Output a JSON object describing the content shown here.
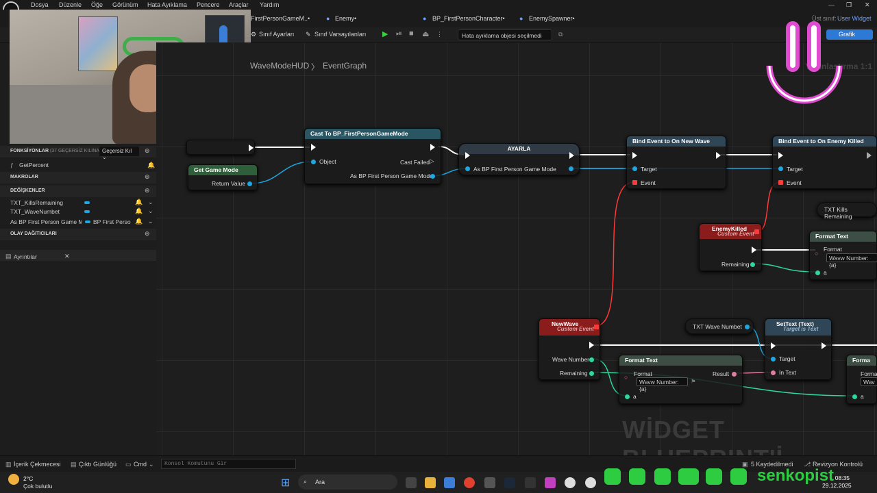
{
  "menu": [
    "Dosya",
    "Düzenle",
    "Öğe",
    "Görünüm",
    "Hata Ayıklama",
    "Pencere",
    "Araçlar",
    "Yardım"
  ],
  "tabs": [
    "FirstPersonGameM..•",
    "Enemy•",
    "BP_FirstPersonCharacter•",
    "EnemySpawner•"
  ],
  "parent_class_label": "Üst sınıf:",
  "parent_class_value": "User Widget",
  "toolbar": {
    "class_settings": "Sınıf Ayarları",
    "class_defaults": "Sınıf Varsayılanları",
    "debug_select": "Hata ayıklama objesi seçilmedi",
    "graph_button": "Grafik"
  },
  "breadcrumb": {
    "widget": "WaveModeHUD",
    "graph": "EventGraph"
  },
  "sidebar": {
    "functions_head": "FONKSİYONLAR",
    "functions_count": "(37 GEÇERSİZ KILINA",
    "override_btn": "Geçersiz Kıl",
    "function_item": "GetPercent",
    "macros_head": "MAKROLAR",
    "variables_head": "DEĞİŞKENLER",
    "variables": [
      {
        "name": "TXT_KillsRemaining",
        "type": ""
      },
      {
        "name": "TXT_WaveNumbet",
        "type": ""
      },
      {
        "name": "As BP First Person Game M",
        "type": "BP First Perso"
      }
    ],
    "dispatchers_head": "OLAY DAĞITICILARI",
    "details_tab": "Ayrıntılar"
  },
  "nodes": {
    "get_game_mode": {
      "title": "Get Game Mode",
      "ret": "Return Value"
    },
    "cast": {
      "title": "Cast To BP_FirstPersonGameMode",
      "object": "Object",
      "failed": "Cast Failed",
      "as": "As BP First Person Game Mode"
    },
    "set": {
      "title": "AYARLA",
      "as": "As BP First Person Game Mode"
    },
    "bind_wave": {
      "title": "Bind Event to On New Wave",
      "target": "Target",
      "event": "Event"
    },
    "bind_enemy": {
      "title": "Bind Event to On Enemy Killed",
      "target": "Target",
      "event": "Event"
    },
    "txt_kills": "TXT Kills Remaining",
    "enemy_killed": {
      "title": "EnemyKilled",
      "sub": "Custom Event",
      "remaining": "Remaining"
    },
    "format1": {
      "title": "Format Text",
      "format": "Format",
      "value": "Wavw Number:{a}",
      "a": "a"
    },
    "new_wave": {
      "title": "NewWave",
      "sub": "Custom Event",
      "wave": "Wave Number",
      "remaining": "Remaining"
    },
    "txt_wave": "TXT Wave Numbet",
    "settext": {
      "title": "SetText (Text)",
      "sub": "Target is Text",
      "target": "Target",
      "intext": "In Text"
    },
    "format2": {
      "title": "Format Text",
      "format": "Format",
      "value": "Wavw Number:{a}",
      "result": "Result",
      "a": "a"
    },
    "format3": {
      "title": "Forma",
      "format": "Forma",
      "value": "Wav",
      "a": "a"
    }
  },
  "watermark": "WİDGET BLUEPRINT'İ",
  "zoom": "Yakınlaştırma 1:1",
  "status": {
    "content": "İçerik Çekmecesi",
    "output": "Çıktı Günlüğü",
    "cmd": "Cmd",
    "console_placeholder": "Konsol Komutunu Gir",
    "saved": "5 Kaydedilmedi",
    "revision": "Revizyon Kontrolü"
  },
  "taskbar": {
    "temp": "2°C",
    "weather": "Çok bulutlu",
    "search": "Ara",
    "time": "08:35",
    "date": "29.12.2025"
  },
  "brand": "senkopist",
  "colors": {
    "exec": "#ffffff",
    "object_pin": "#1ea7e1",
    "text_pin": "#e07ea0",
    "int_pin": "#2fd6a0",
    "event_pin": "#ff3838",
    "accent": "#2c7ad6"
  }
}
